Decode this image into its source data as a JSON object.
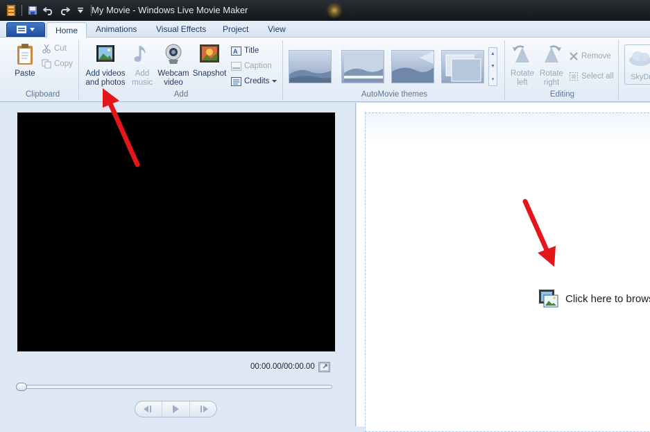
{
  "window": {
    "title": "My Movie - Windows Live Movie Maker"
  },
  "tabs": [
    "Home",
    "Animations",
    "Visual Effects",
    "Project",
    "View"
  ],
  "clipboard": {
    "paste": "Paste",
    "cut": "Cut",
    "copy": "Copy",
    "label": "Clipboard"
  },
  "add": {
    "add_videos_l1": "Add videos",
    "add_videos_l2": "and photos",
    "add_music_l1": "Add",
    "add_music_l2": "music",
    "webcam_l1": "Webcam",
    "webcam_l2": "video",
    "snapshot": "Snapshot",
    "title": "Title",
    "caption": "Caption",
    "credits": "Credits",
    "label": "Add"
  },
  "themes": {
    "label": "AutoMovie themes"
  },
  "editing": {
    "rotate_left_l1": "Rotate",
    "rotate_left_l2": "left",
    "rotate_right_l1": "Rotate",
    "rotate_right_l2": "right",
    "remove": "Remove",
    "select_all": "Select all",
    "label": "Editing"
  },
  "share": {
    "skydrive": "SkyDr"
  },
  "player": {
    "timecode": "00:00.00/00:00.00"
  },
  "storyboard": {
    "browse": "Click here to browse"
  },
  "colors": {
    "accent": "#1e4e9d",
    "annotation_arrow": "#e5161b"
  }
}
